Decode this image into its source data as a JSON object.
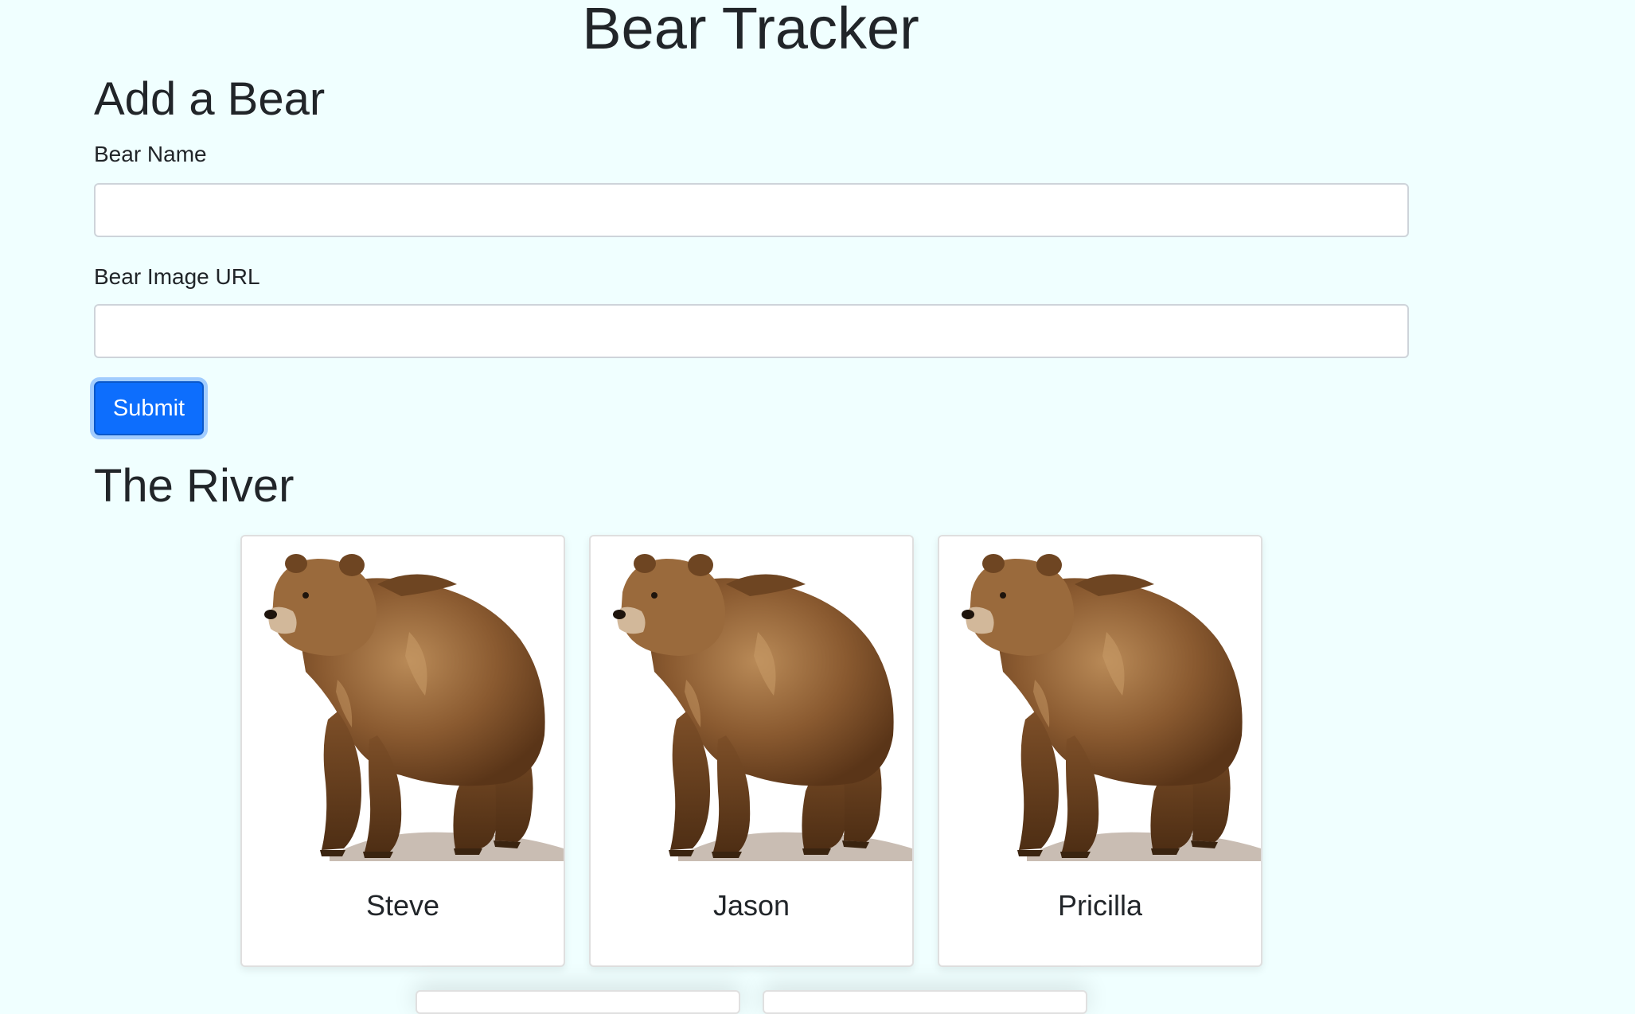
{
  "header": {
    "title": "Bear Tracker"
  },
  "form": {
    "title": "Add a Bear",
    "name_label": "Bear Name",
    "name_value": "",
    "image_label": "Bear Image URL",
    "image_value": "",
    "submit_label": "Submit",
    "submit_color": "#0d6efd"
  },
  "river": {
    "title": "The River",
    "bears": [
      {
        "name": "Steve",
        "image": "brown-bear-photo"
      },
      {
        "name": "Jason",
        "image": "brown-bear-photo"
      },
      {
        "name": "Pricilla",
        "image": "brown-bear-photo"
      }
    ]
  },
  "colors": {
    "background": "#f0ffff",
    "text": "#212529",
    "accent": "#0d6efd"
  }
}
